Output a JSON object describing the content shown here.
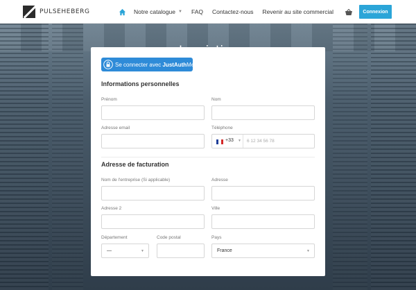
{
  "header": {
    "brand": "PULSEHEBERG",
    "nav": [
      {
        "label": "Notre catalogue",
        "dropdown": true
      },
      {
        "label": "FAQ"
      },
      {
        "label": "Contactez-nous"
      },
      {
        "label": "Revenir au site commercial"
      }
    ],
    "login_label": "Connexion",
    "accent_color": "#2ba5d8"
  },
  "page": {
    "title": "Inscription"
  },
  "justauth": {
    "prefix": "Se connecter avec ",
    "brand": "JustAuth",
    "suffix": "Me"
  },
  "personal": {
    "title": "Informations personnelles",
    "prenom_label": "Prénom",
    "nom_label": "Nom",
    "email_label": "Adresse email",
    "phone_label": "Téléphone",
    "phone_code": "+33",
    "phone_placeholder": "6 12 34 56 78"
  },
  "billing": {
    "title": "Adresse de facturation",
    "company_label": "Nom de l'entreprise (Si applicable)",
    "address_label": "Adresse",
    "address2_label": "Adresse 2",
    "city_label": "Ville",
    "department_label": "Département",
    "department_value": "—",
    "postal_label": "Code postal",
    "country_label": "Pays",
    "country_value": "France"
  }
}
